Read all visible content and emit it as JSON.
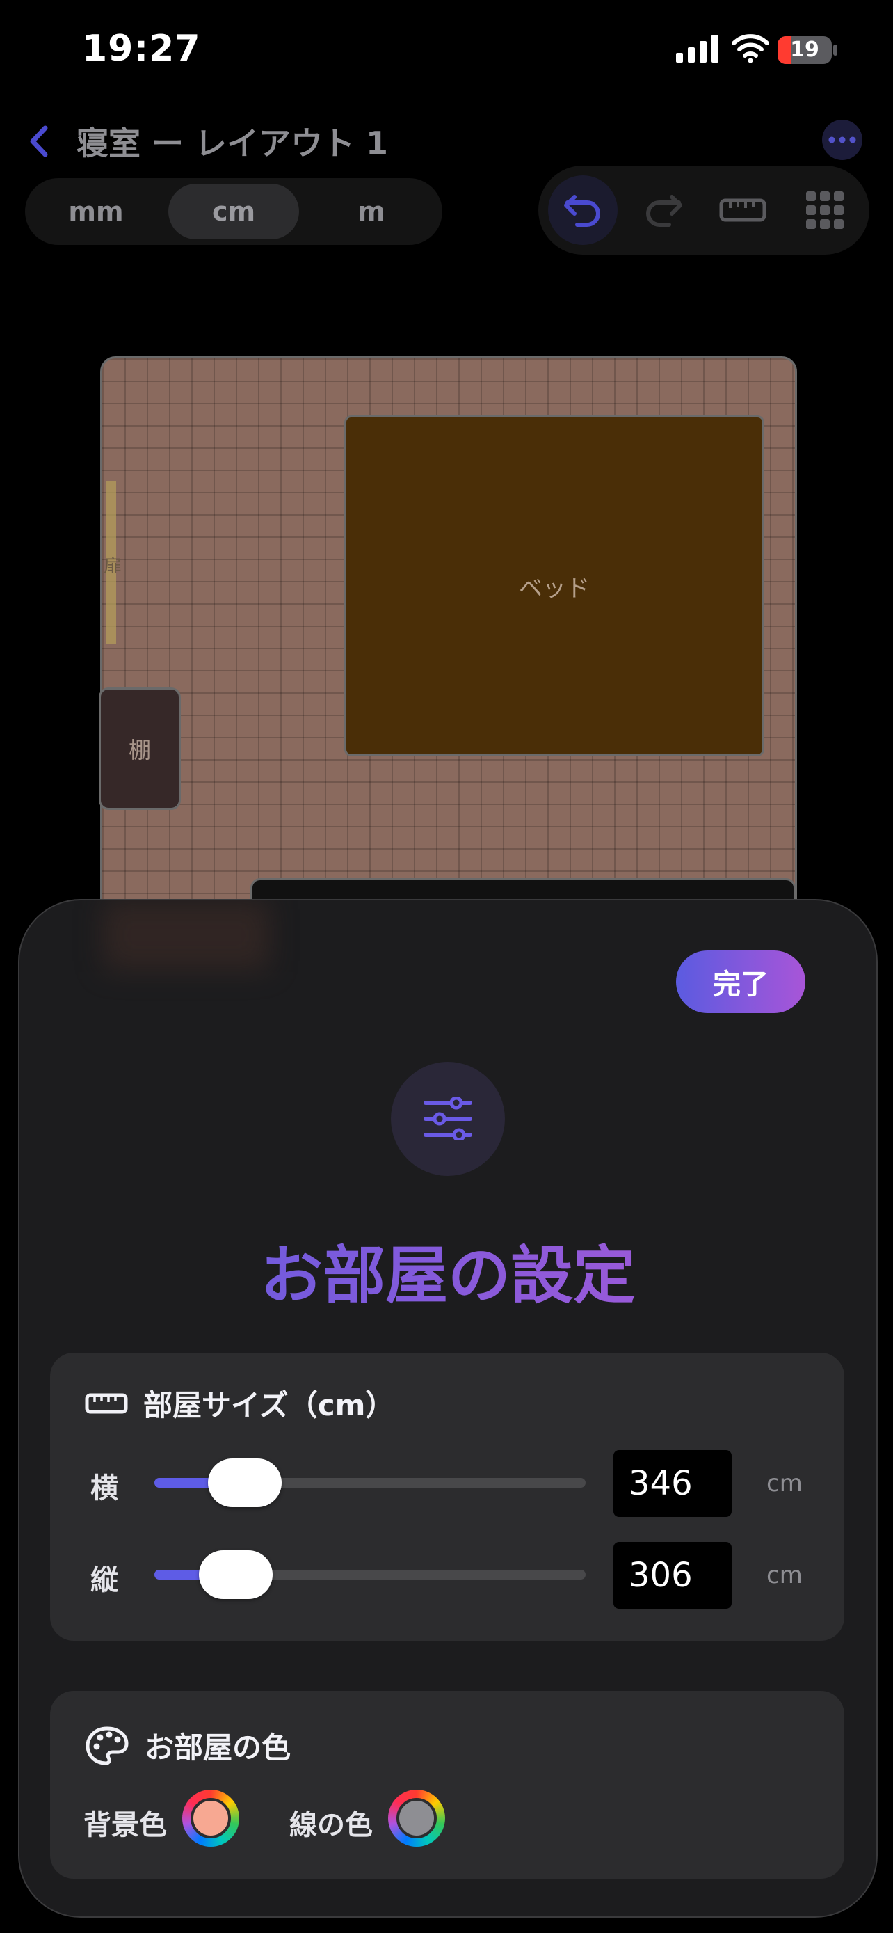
{
  "status_bar": {
    "time": "19:27",
    "battery": "19"
  },
  "nav": {
    "title": "寝室 ー レイアウト 1"
  },
  "units": {
    "options": [
      "mm",
      "cm",
      "m"
    ],
    "selected": "cm"
  },
  "toolbar": {
    "icons": [
      "undo-icon",
      "redo-icon",
      "ruler-icon",
      "grid-icon"
    ]
  },
  "canvas": {
    "bed_label": "ベッド",
    "door_label": "扉",
    "shelf_label": "棚"
  },
  "sheet": {
    "done_label": "完了",
    "title": "お部屋の設定",
    "size_section": {
      "title": "部屋サイズ（cm）",
      "width_label": "横",
      "width_value": "346",
      "width_slider_fraction": 0.19,
      "height_label": "縦",
      "height_value": "306",
      "height_slider_fraction": 0.17,
      "unit": "cm"
    },
    "color_section": {
      "title": "お部屋の色",
      "background_label": "背景色",
      "background_color": "#f7a892",
      "line_label": "線の色",
      "line_color": "#8e8e93"
    }
  },
  "colors": {
    "accent": "#5e5ce6",
    "accent_end": "#b15ad6"
  }
}
